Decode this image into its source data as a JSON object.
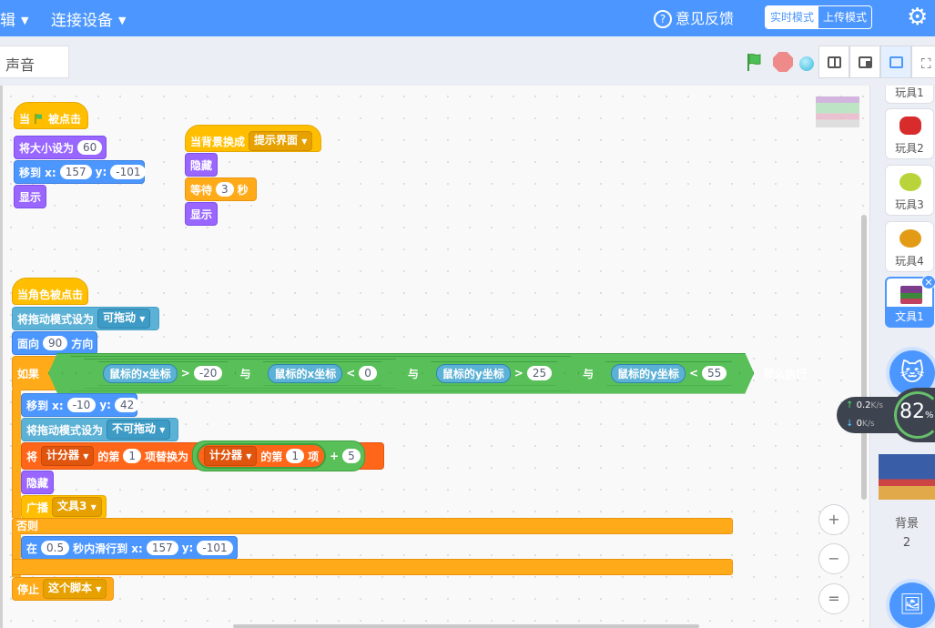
{
  "topbar": {
    "menu1": "辑",
    "menu2": "连接设备",
    "feedback": "意见反馈",
    "mode_realtime": "实时模式",
    "mode_upload": "上传模式"
  },
  "tabs": {
    "sound": "声音"
  },
  "scripts": {
    "s1": {
      "hat": "当",
      "hat2": "被点击",
      "size_label": "将大小设为",
      "size_val": "60",
      "goto": "移到 x:",
      "gx": "157",
      "y": "y:",
      "gy": "-101",
      "show": "显示"
    },
    "s2": {
      "hat": "当背景换成",
      "backdrop": "提示界面",
      "hide": "隐藏",
      "wait": "等待",
      "wait_val": "3",
      "sec": "秒",
      "show": "显示"
    },
    "s3": {
      "hat": "当角色被点击",
      "drag": "将拖动模式设为",
      "drag_val": "可拖动",
      "dir": "面向",
      "dir_val": "90",
      "dir_suffix": "方向",
      "if": "如果",
      "mx": "鼠标的x坐标",
      "gt": ">",
      "v1": "-20",
      "and": "与",
      "lt": "<",
      "v2": "0",
      "my": "鼠标的y坐标",
      "v3": "25",
      "v4": "55",
      "then": "那么执行",
      "goto": "移到 x:",
      "gx": "-10",
      "y": "y:",
      "gy": "42",
      "drag2_val": "不可拖动",
      "jiang": "将",
      "list": "计分器",
      "di": "的第",
      "idx": "1",
      "replace": "项替换为",
      "list2": "计分器",
      "di2": "的第",
      "idx2": "1",
      "item": "项",
      "plus": "+",
      "addv": "5",
      "hide": "隐藏",
      "broadcast": "广播",
      "msg": "文具3",
      "else": "否则",
      "glide_in": "在",
      "glide_t": "0.5",
      "glide_mid": "秒内滑行到 x:",
      "glide_x": "157",
      "glide_y": "-101",
      "stop": "停止",
      "stop_opt": "这个脚本"
    }
  },
  "sprites": [
    {
      "label": "玩具1"
    },
    {
      "label": "玩具2"
    },
    {
      "label": "玩具3"
    },
    {
      "label": "玩具4"
    },
    {
      "label": "文具1"
    }
  ],
  "backdrop": {
    "label": "背景",
    "count": "2"
  },
  "net": {
    "up": "0.2",
    "down": "0",
    "unit": "K/s",
    "pct": "82",
    "pct_sym": "%"
  },
  "zoom": {
    "in": "+",
    "out": "−",
    "reset": "="
  }
}
